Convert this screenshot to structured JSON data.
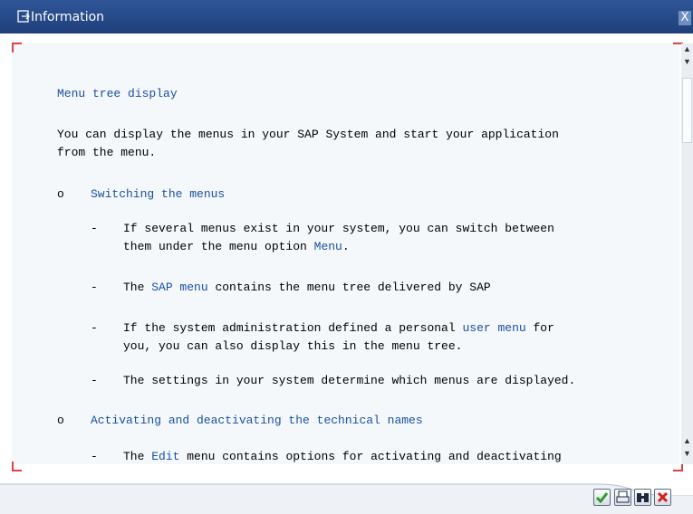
{
  "window": {
    "title": "Information",
    "close_label": "X"
  },
  "help": {
    "heading": "Menu tree display",
    "intro_1": "You can display the menus in your SAP System and start your application",
    "intro_2": "from the menu.",
    "sections": [
      {
        "bullet": "o",
        "title": "Switching the menus",
        "items": [
          {
            "dash": "-",
            "l1_pre": "If several menus exist in your system, you can switch between",
            "l2_pre": "them under the menu option ",
            "l2_link": "Menu",
            "l2_post": "."
          },
          {
            "dash": "-",
            "pre": "The ",
            "link": "SAP menu",
            "post": " contains the menu tree delivered by SAP"
          },
          {
            "dash": "-",
            "l1_pre": "If the system administration defined a personal ",
            "l1_link": "user menu",
            "l1_post": " for",
            "l2": "you, you can also display this in the menu tree."
          },
          {
            "dash": "-",
            "text": "The settings in your system determine which menus are displayed."
          }
        ]
      },
      {
        "bullet": "o",
        "title": "Activating and deactivating the technical names",
        "items": [
          {
            "dash": "-",
            "pre": "The ",
            "link": "Edit",
            "post": " menu contains options for activating and deactivating"
          }
        ]
      }
    ]
  },
  "footer": {
    "buttons": [
      {
        "icon": "checkmark-icon",
        "color": "#2e9a2e"
      },
      {
        "icon": "print-icon",
        "color": "#1c2a40"
      },
      {
        "icon": "find-icon",
        "color": "#1c2a40"
      },
      {
        "icon": "cancel-icon",
        "color": "#d02020"
      }
    ]
  },
  "colors": {
    "title_bar": "#2a4f8f",
    "link": "#1a4f9f",
    "content_bg": "#f4f8fb"
  }
}
